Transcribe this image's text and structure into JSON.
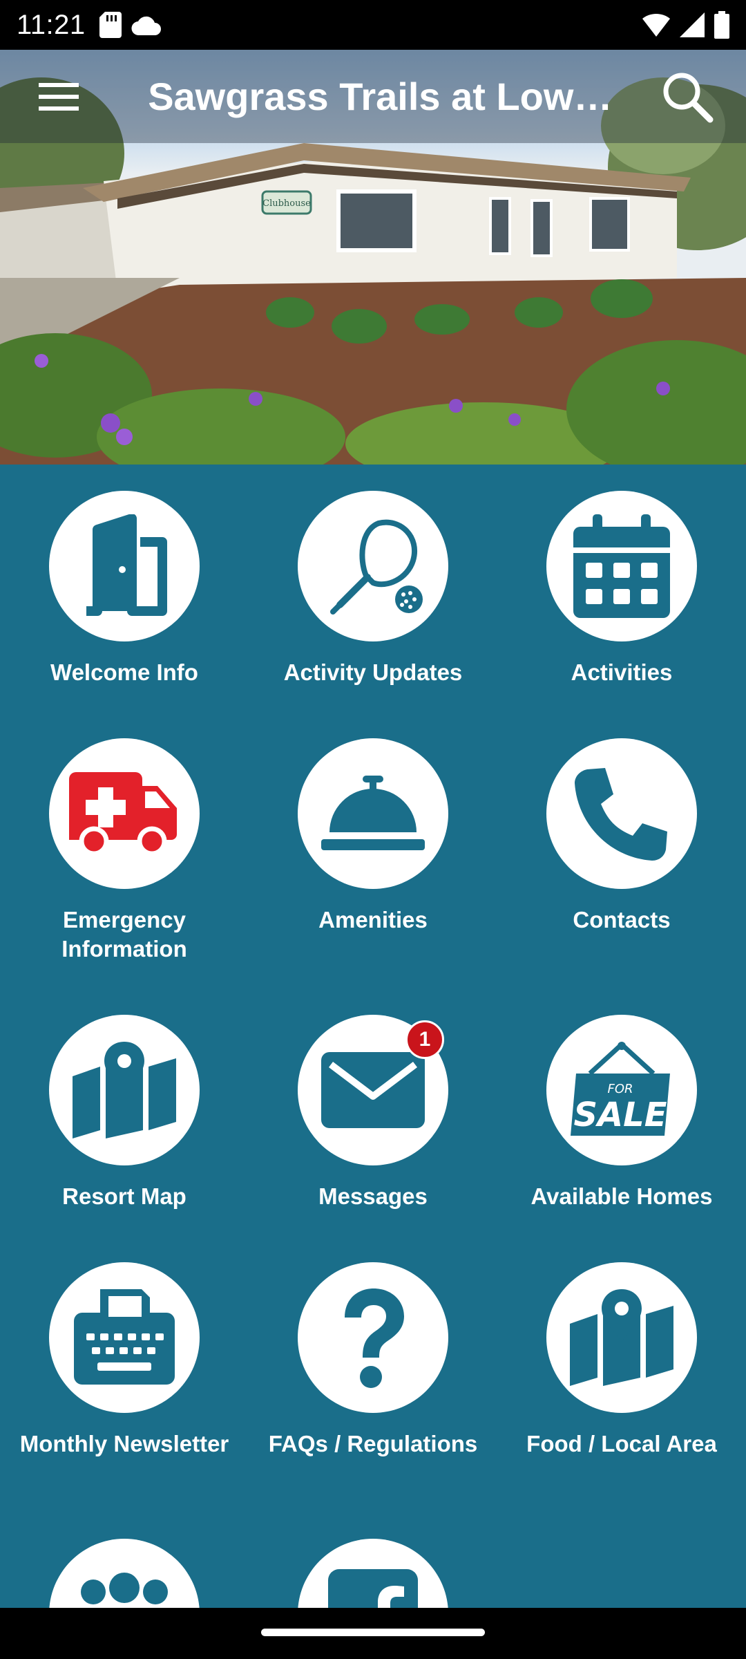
{
  "status_bar": {
    "time": "11:21"
  },
  "app_bar": {
    "title": "Sawgrass Trails at Low…"
  },
  "hero": {
    "sign_text": "Clubhouse"
  },
  "tiles": [
    {
      "label": "Welcome Info",
      "icon": "door-icon"
    },
    {
      "label": "Activity Updates",
      "icon": "pickleball-paddle-icon"
    },
    {
      "label": "Activities",
      "icon": "calendar-icon"
    },
    {
      "label": "Emergency Information",
      "icon": "ambulance-icon"
    },
    {
      "label": "Amenities",
      "icon": "service-bell-icon"
    },
    {
      "label": "Contacts",
      "icon": "phone-icon"
    },
    {
      "label": "Resort Map",
      "icon": "map-icon"
    },
    {
      "label": "Messages",
      "icon": "envelope-icon",
      "badge": "1"
    },
    {
      "label": "Available Homes",
      "icon": "for-sale-sign-icon"
    },
    {
      "label": "Monthly Newsletter",
      "icon": "typewriter-icon"
    },
    {
      "label": "FAQs / Regulations",
      "icon": "question-icon"
    },
    {
      "label": "Food / Local Area",
      "icon": "map-pin-icon"
    },
    {
      "label": "",
      "icon": "group-icon"
    },
    {
      "label": "",
      "icon": "facebook-icon"
    }
  ],
  "colors": {
    "background": "#1a6e8a",
    "icon": "#1a6e8a",
    "emergency_icon": "#e3212a",
    "badge": "#c9141b"
  },
  "icons": {
    "sale_sign_top": "FOR",
    "sale_sign_main": "SALE"
  }
}
